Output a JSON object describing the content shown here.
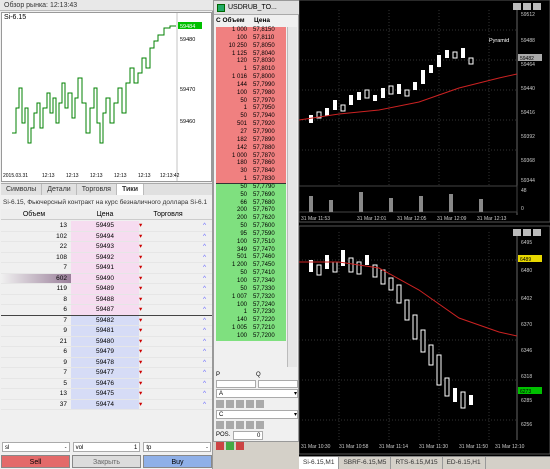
{
  "market_watch": {
    "title": "Обзор рынка: 12:13:43",
    "symbol": "Si-6.15"
  },
  "tick_chart": {
    "y_ticks": [
      "59480",
      "59470",
      "59460"
    ],
    "x_ticks": [
      "2015.03.31",
      "12:13",
      "12:13",
      "12:13",
      "12:13",
      "12:13",
      "12:13:42"
    ],
    "last_price": "59484"
  },
  "tabs": [
    "Символы",
    "Детали",
    "Торговля",
    "Тики"
  ],
  "active_tab": "Тики",
  "dom": {
    "info": "Si-6.15, Фьючерсный контракт на курс безналичного доллара Si-6.1",
    "headers": [
      "Объем",
      "Цена",
      "Торговля"
    ],
    "asks": [
      {
        "vol": "13",
        "price": "59495"
      },
      {
        "vol": "102",
        "price": "59494"
      },
      {
        "vol": "22",
        "price": "59493"
      },
      {
        "vol": "108",
        "price": "59492"
      },
      {
        "vol": "7",
        "price": "59491"
      },
      {
        "vol": "602",
        "price": "59490"
      },
      {
        "vol": "119",
        "price": "59489"
      },
      {
        "vol": "8",
        "price": "59488"
      },
      {
        "vol": "6",
        "price": "59487"
      }
    ],
    "bids": [
      {
        "vol": "7",
        "price": "59482"
      },
      {
        "vol": "9",
        "price": "59481"
      },
      {
        "vol": "21",
        "price": "59480"
      },
      {
        "vol": "6",
        "price": "59479"
      },
      {
        "vol": "9",
        "price": "59478"
      },
      {
        "vol": "7",
        "price": "59477"
      },
      {
        "vol": "5",
        "price": "59476"
      },
      {
        "vol": "13",
        "price": "59475"
      },
      {
        "vol": "37",
        "price": "59474"
      }
    ],
    "sl_label": "sl",
    "vol_label": "vol",
    "tp_label": "tp",
    "sl_val": "-",
    "vol_val": "1",
    "tp_val": "-",
    "sell": "Sell",
    "close": "Закрыть",
    "buy": "Buy"
  },
  "mid_book": {
    "title": "USDRUB_TO...",
    "headers": [
      "С Объем",
      "Цена"
    ],
    "asks": [
      [
        "1 000",
        "57,8150"
      ],
      [
        "100",
        "57,8110"
      ],
      [
        "10 250",
        "57,8050"
      ],
      [
        "1 125",
        "57,8040"
      ],
      [
        "120",
        "57,8030"
      ],
      [
        "1",
        "57,8010"
      ],
      [
        "1 016",
        "57,8000"
      ],
      [
        "144",
        "57,7990"
      ],
      [
        "100",
        "57,7980"
      ],
      [
        "50",
        "57,7970"
      ],
      [
        "1",
        "57,7950"
      ],
      [
        "50",
        "57,7940"
      ],
      [
        "501",
        "57,7920"
      ],
      [
        "27",
        "57,7900"
      ],
      [
        "182",
        "57,7890"
      ],
      [
        "142",
        "57,7880"
      ],
      [
        "1 000",
        "57,7870"
      ],
      [
        "180",
        "57,7860"
      ],
      [
        "30",
        "57,7840"
      ],
      [
        "1",
        "57,7830"
      ]
    ],
    "bids": [
      [
        "50",
        "57,7790"
      ],
      [
        "50",
        "57,7690"
      ],
      [
        "66",
        "57,7680"
      ],
      [
        "200",
        "57,7670"
      ],
      [
        "200",
        "57,7620"
      ],
      [
        "50",
        "57,7600"
      ],
      [
        "95",
        "57,7590"
      ],
      [
        "100",
        "57,7510"
      ],
      [
        "349",
        "57,7470"
      ],
      [
        "501",
        "57,7460"
      ],
      [
        "1 200",
        "57,7450"
      ],
      [
        "50",
        "57,7410"
      ],
      [
        "100",
        "57,7340"
      ],
      [
        "50",
        "57,7330"
      ],
      [
        "1 007",
        "57,7320"
      ],
      [
        "100",
        "57,7240"
      ],
      [
        "1",
        "57,7230"
      ],
      [
        "140",
        "57,7220"
      ],
      [
        "1 005",
        "57,7210"
      ],
      [
        "100",
        "57,7200"
      ]
    ],
    "p_label": "P",
    "q_label": "Q",
    "a_label": "A",
    "c_label": "C",
    "pos_label": "POS.",
    "pos_val": "0"
  },
  "chart_top": {
    "label": "Pyramid",
    "y_ticks": [
      "59512",
      "59488",
      "59464",
      "59440",
      "59416",
      "59392",
      "59368",
      "59344"
    ],
    "bid_price": "59482",
    "ind_ticks": [
      "48",
      "0"
    ],
    "x_ticks": [
      "31 Mar 11:53",
      "31 Mar 12:01",
      "31 Mar 12:05",
      "31 Mar 12:09",
      "31 Mar 12:13"
    ]
  },
  "chart_bot": {
    "y_ticks": [
      "6495",
      "6480",
      "6402",
      "6370",
      "6346",
      "6318",
      "6285",
      "6256"
    ],
    "ask_price": "6489",
    "bid_price": "6273",
    "x_ticks": [
      "31 Mar 10:30",
      "31 Mar 10:58",
      "31 Mar 11:14",
      "31 Mar 11:30",
      "31 Mar 11:50",
      "31 Mar 12:10"
    ]
  },
  "chart_tabs": [
    "Si-6.15,M1",
    "SBRF-6.15,M5",
    "RTS-6.15,M15",
    "ED-6.15,H1"
  ],
  "colors": {
    "ask": "#f08080",
    "bid": "#7fe07f",
    "chart_bg": "#000000",
    "candle_up": "#ffffff",
    "ma": "#cc2222"
  }
}
